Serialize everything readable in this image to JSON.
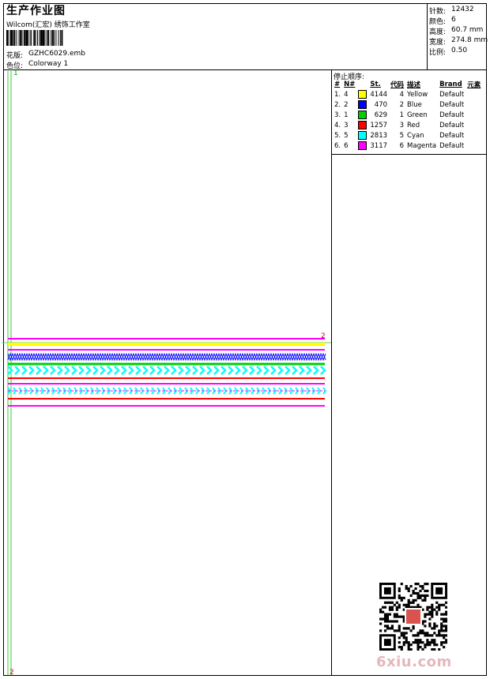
{
  "header": {
    "title": "生产作业图",
    "company": "Wilcom(汇宏) 绣饰工作室",
    "design_label": "花版:",
    "design_value": "GZHC6029.emb",
    "colorway_label": "色位:",
    "colorway_value": "Colorway 1"
  },
  "info": [
    {
      "label": "针数:",
      "value": "12432"
    },
    {
      "label": "颜色:",
      "value": "6"
    },
    {
      "label": "高度:",
      "value": "60.7 mm"
    },
    {
      "label": "宽度:",
      "value": "274.8 mm"
    },
    {
      "label": "比例:",
      "value": "0.50"
    }
  ],
  "stop_sequence": {
    "title": "停止顺序:",
    "headers": [
      "#",
      "N#",
      "St.",
      "代码",
      "描述",
      "Brand",
      "元素"
    ],
    "rows": [
      {
        "idx": "1.",
        "n": "4",
        "color": "#ffff00",
        "st": "4144",
        "code": "4",
        "desc": "Yellow",
        "brand": "Default"
      },
      {
        "idx": "2.",
        "n": "2",
        "color": "#0000ff",
        "st": "470",
        "code": "2",
        "desc": "Blue",
        "brand": "Default"
      },
      {
        "idx": "3.",
        "n": "1",
        "color": "#00cc00",
        "st": "629",
        "code": "1",
        "desc": "Green",
        "brand": "Default"
      },
      {
        "idx": "4.",
        "n": "3",
        "color": "#ff0000",
        "st": "1257",
        "code": "3",
        "desc": "Red",
        "brand": "Default"
      },
      {
        "idx": "5.",
        "n": "5",
        "color": "#00ffff",
        "st": "2813",
        "code": "5",
        "desc": "Cyan",
        "brand": "Default"
      },
      {
        "idx": "6.",
        "n": "6",
        "color": "#ff00ff",
        "st": "3117",
        "code": "6",
        "desc": "Magenta",
        "brand": "Default"
      }
    ]
  },
  "markers": {
    "top_left": "1",
    "right": "2",
    "bottom_left": "2"
  },
  "watermark": "6xiu.com"
}
